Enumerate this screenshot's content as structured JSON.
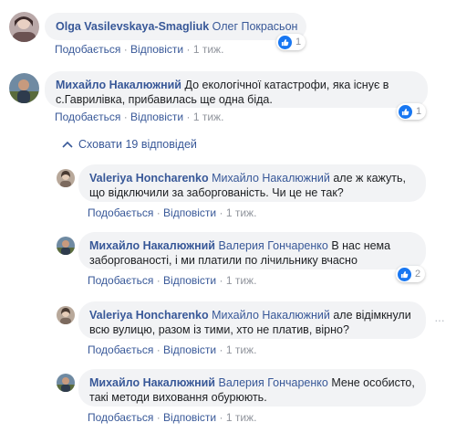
{
  "colors": {
    "link": "#385898",
    "bubble": "#f2f3f5",
    "like": "#1877f2",
    "muted": "#90949c"
  },
  "actions": {
    "like": "Подобається",
    "reply": "Відповісти",
    "sep": "·"
  },
  "collapse_label": "Сховати 19 відповідей",
  "comments": [
    {
      "author": "Olga Vasilevskaya-Smagliuk",
      "mention": "Олег Покрасьон",
      "text": "",
      "time": "1 тиж.",
      "reactions": "1"
    },
    {
      "author": "Михайло Накалюжний",
      "mention": "",
      "text": "До екологічної катастрофи, яка існує в с.Гаврилівка, прибавилась ще одна біда.",
      "time": "1 тиж.",
      "reactions": "1"
    }
  ],
  "replies": [
    {
      "author": "Valeriya Honcharenko",
      "mention": "Михайло Накалюжний",
      "text": "але ж кажуть, що відключили за заборгованість. Чи це не так?",
      "time": "1 тиж."
    },
    {
      "author": "Михайло Накалюжний",
      "mention": "Валерия Гончаренко",
      "text": "В нас нема заборгованості, і ми платили по лічильнику вчасно",
      "time": "1 тиж.",
      "reactions": "2"
    },
    {
      "author": "Valeriya Honcharenko",
      "mention": "Михайло Накалюжний",
      "text": "але відімкнули всю вулицю, разом із тими, хто не платив, вірно?",
      "time": "1 тиж."
    },
    {
      "author": "Михайло Накалюжний",
      "mention": "Валерия Гончаренко",
      "text": "Мене особисто, такі методи виховання обурюють.",
      "time": "1 тиж."
    }
  ]
}
